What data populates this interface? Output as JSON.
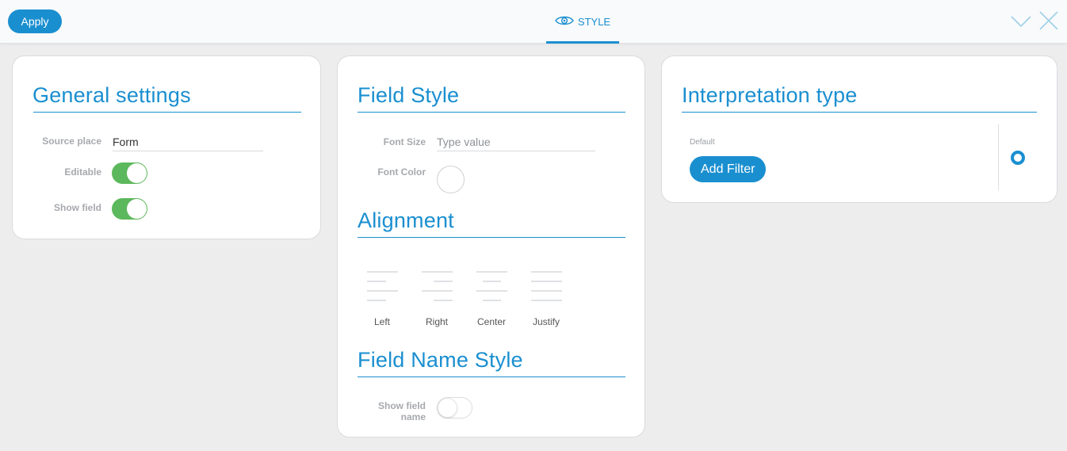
{
  "toolbar": {
    "apply_label": "Apply",
    "tab_label": "STYLE",
    "icons": {
      "tab": "eye-icon",
      "collapse": "chevron-down-icon",
      "close": "close-icon"
    }
  },
  "general": {
    "title": "General settings",
    "source_place": {
      "label": "Source place",
      "value": "Form"
    },
    "editable": {
      "label": "Editable",
      "on": true
    },
    "show_field": {
      "label": "Show field",
      "on": true
    }
  },
  "field_style": {
    "title": "Field Style",
    "font_size": {
      "label": "Font Size",
      "placeholder": "Type value"
    },
    "font_color": {
      "label": "Font Color"
    },
    "alignment": {
      "title": "Alignment",
      "options": [
        {
          "label": "Left",
          "icon": "align-left-icon"
        },
        {
          "label": "Right",
          "icon": "align-right-icon"
        },
        {
          "label": "Center",
          "icon": "align-center-icon"
        },
        {
          "label": "Justify",
          "icon": "align-justify-icon"
        }
      ]
    },
    "name_style": {
      "title": "Field Name Style",
      "show_name_label_line1": "Show field",
      "show_name_label_line2": "name",
      "show_name_on": false
    }
  },
  "interpretation": {
    "title": "Interpretation type",
    "default_label": "Default",
    "add_filter_label": "Add Filter",
    "selected": true
  },
  "colors": {
    "accent": "#1a8fd0",
    "toggle_on": "#5cb85c",
    "background": "#ededee"
  }
}
